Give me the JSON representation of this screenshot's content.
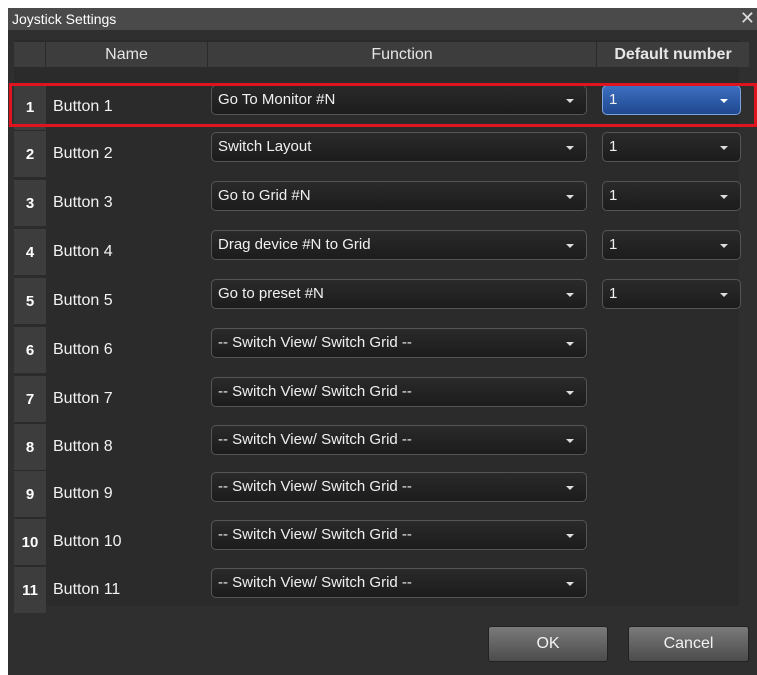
{
  "window": {
    "title": "Joystick Settings"
  },
  "columns": {
    "name": "Name",
    "function": "Function",
    "default_number": "Default number"
  },
  "rows": [
    {
      "num": "1",
      "name": "Button 1",
      "function": "Go To Monitor #N",
      "default": "1"
    },
    {
      "num": "2",
      "name": "Button 2",
      "function": "Switch Layout",
      "default": "1"
    },
    {
      "num": "3",
      "name": "Button 3",
      "function": "Go to Grid #N",
      "default": "1"
    },
    {
      "num": "4",
      "name": "Button 4",
      "function": "Drag device #N to Grid",
      "default": "1"
    },
    {
      "num": "5",
      "name": "Button 5",
      "function": "Go to preset #N",
      "default": "1"
    },
    {
      "num": "6",
      "name": "Button 6",
      "function": "-- Switch View/ Switch Grid --"
    },
    {
      "num": "7",
      "name": "Button 7",
      "function": "-- Switch View/ Switch Grid --"
    },
    {
      "num": "8",
      "name": "Button 8",
      "function": "-- Switch View/ Switch Grid --"
    },
    {
      "num": "9",
      "name": "Button 9",
      "function": "-- Switch View/ Switch Grid --"
    },
    {
      "num": "10",
      "name": "Button 10",
      "function": "-- Switch View/ Switch Grid --"
    },
    {
      "num": "11",
      "name": "Button 11",
      "function": "-- Switch View/ Switch Grid --"
    }
  ],
  "buttons": {
    "ok": "OK",
    "cancel": "Cancel"
  },
  "colors": {
    "highlight": "#e0141e",
    "selected": "#2d5fae"
  }
}
